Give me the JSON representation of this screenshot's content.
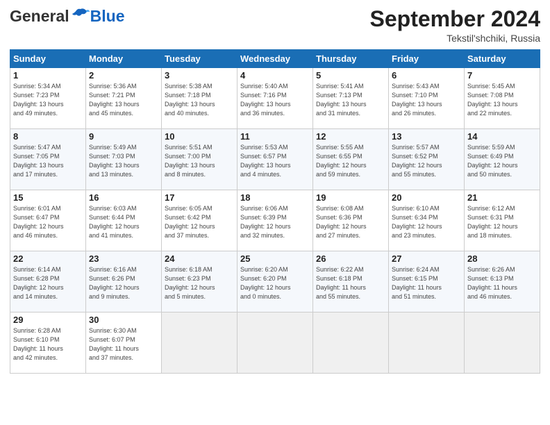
{
  "header": {
    "logo_general": "General",
    "logo_blue": "Blue",
    "month": "September 2024",
    "location": "Tekstil'shchiki, Russia"
  },
  "weekdays": [
    "Sunday",
    "Monday",
    "Tuesday",
    "Wednesday",
    "Thursday",
    "Friday",
    "Saturday"
  ],
  "weeks": [
    [
      {
        "day": "1",
        "info": "Sunrise: 5:34 AM\nSunset: 7:23 PM\nDaylight: 13 hours\nand 49 minutes."
      },
      {
        "day": "2",
        "info": "Sunrise: 5:36 AM\nSunset: 7:21 PM\nDaylight: 13 hours\nand 45 minutes."
      },
      {
        "day": "3",
        "info": "Sunrise: 5:38 AM\nSunset: 7:18 PM\nDaylight: 13 hours\nand 40 minutes."
      },
      {
        "day": "4",
        "info": "Sunrise: 5:40 AM\nSunset: 7:16 PM\nDaylight: 13 hours\nand 36 minutes."
      },
      {
        "day": "5",
        "info": "Sunrise: 5:41 AM\nSunset: 7:13 PM\nDaylight: 13 hours\nand 31 minutes."
      },
      {
        "day": "6",
        "info": "Sunrise: 5:43 AM\nSunset: 7:10 PM\nDaylight: 13 hours\nand 26 minutes."
      },
      {
        "day": "7",
        "info": "Sunrise: 5:45 AM\nSunset: 7:08 PM\nDaylight: 13 hours\nand 22 minutes."
      }
    ],
    [
      {
        "day": "8",
        "info": "Sunrise: 5:47 AM\nSunset: 7:05 PM\nDaylight: 13 hours\nand 17 minutes."
      },
      {
        "day": "9",
        "info": "Sunrise: 5:49 AM\nSunset: 7:03 PM\nDaylight: 13 hours\nand 13 minutes."
      },
      {
        "day": "10",
        "info": "Sunrise: 5:51 AM\nSunset: 7:00 PM\nDaylight: 13 hours\nand 8 minutes."
      },
      {
        "day": "11",
        "info": "Sunrise: 5:53 AM\nSunset: 6:57 PM\nDaylight: 13 hours\nand 4 minutes."
      },
      {
        "day": "12",
        "info": "Sunrise: 5:55 AM\nSunset: 6:55 PM\nDaylight: 12 hours\nand 59 minutes."
      },
      {
        "day": "13",
        "info": "Sunrise: 5:57 AM\nSunset: 6:52 PM\nDaylight: 12 hours\nand 55 minutes."
      },
      {
        "day": "14",
        "info": "Sunrise: 5:59 AM\nSunset: 6:49 PM\nDaylight: 12 hours\nand 50 minutes."
      }
    ],
    [
      {
        "day": "15",
        "info": "Sunrise: 6:01 AM\nSunset: 6:47 PM\nDaylight: 12 hours\nand 46 minutes."
      },
      {
        "day": "16",
        "info": "Sunrise: 6:03 AM\nSunset: 6:44 PM\nDaylight: 12 hours\nand 41 minutes."
      },
      {
        "day": "17",
        "info": "Sunrise: 6:05 AM\nSunset: 6:42 PM\nDaylight: 12 hours\nand 37 minutes."
      },
      {
        "day": "18",
        "info": "Sunrise: 6:06 AM\nSunset: 6:39 PM\nDaylight: 12 hours\nand 32 minutes."
      },
      {
        "day": "19",
        "info": "Sunrise: 6:08 AM\nSunset: 6:36 PM\nDaylight: 12 hours\nand 27 minutes."
      },
      {
        "day": "20",
        "info": "Sunrise: 6:10 AM\nSunset: 6:34 PM\nDaylight: 12 hours\nand 23 minutes."
      },
      {
        "day": "21",
        "info": "Sunrise: 6:12 AM\nSunset: 6:31 PM\nDaylight: 12 hours\nand 18 minutes."
      }
    ],
    [
      {
        "day": "22",
        "info": "Sunrise: 6:14 AM\nSunset: 6:28 PM\nDaylight: 12 hours\nand 14 minutes."
      },
      {
        "day": "23",
        "info": "Sunrise: 6:16 AM\nSunset: 6:26 PM\nDaylight: 12 hours\nand 9 minutes."
      },
      {
        "day": "24",
        "info": "Sunrise: 6:18 AM\nSunset: 6:23 PM\nDaylight: 12 hours\nand 5 minutes."
      },
      {
        "day": "25",
        "info": "Sunrise: 6:20 AM\nSunset: 6:20 PM\nDaylight: 12 hours\nand 0 minutes."
      },
      {
        "day": "26",
        "info": "Sunrise: 6:22 AM\nSunset: 6:18 PM\nDaylight: 11 hours\nand 55 minutes."
      },
      {
        "day": "27",
        "info": "Sunrise: 6:24 AM\nSunset: 6:15 PM\nDaylight: 11 hours\nand 51 minutes."
      },
      {
        "day": "28",
        "info": "Sunrise: 6:26 AM\nSunset: 6:13 PM\nDaylight: 11 hours\nand 46 minutes."
      }
    ],
    [
      {
        "day": "29",
        "info": "Sunrise: 6:28 AM\nSunset: 6:10 PM\nDaylight: 11 hours\nand 42 minutes."
      },
      {
        "day": "30",
        "info": "Sunrise: 6:30 AM\nSunset: 6:07 PM\nDaylight: 11 hours\nand 37 minutes."
      },
      {
        "day": "",
        "info": ""
      },
      {
        "day": "",
        "info": ""
      },
      {
        "day": "",
        "info": ""
      },
      {
        "day": "",
        "info": ""
      },
      {
        "day": "",
        "info": ""
      }
    ]
  ]
}
